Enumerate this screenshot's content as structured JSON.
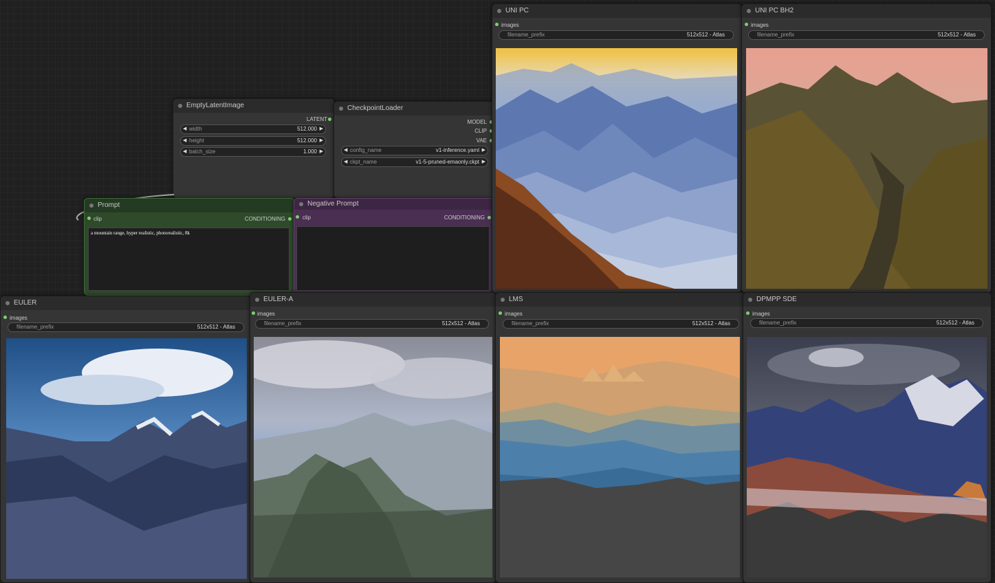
{
  "empty_latent": {
    "title": "EmptyLatentImage",
    "output": "LATENT",
    "widgets": [
      {
        "label": "width",
        "value": "512.000"
      },
      {
        "label": "height",
        "value": "512.000"
      },
      {
        "label": "batch_size",
        "value": "1.000"
      }
    ]
  },
  "checkpoint": {
    "title": "CheckpointLoader",
    "outputs": [
      "MODEL",
      "CLIP",
      "VAE"
    ],
    "widgets": [
      {
        "label": "config_name",
        "value": "v1-inference.yaml"
      },
      {
        "label": "ckpt_name",
        "value": "v1-5-pruned-emaonly.ckpt"
      }
    ]
  },
  "prompt": {
    "title": "Prompt",
    "input": "clip",
    "output": "CONDITIONING",
    "text": "a mountain range, hyper realistic, photorealistic, 8k"
  },
  "negative": {
    "title": "Negative Prompt",
    "input": "clip",
    "output": "CONDITIONING",
    "text": ""
  },
  "previews": [
    {
      "title": "UNI PC",
      "input": "images",
      "prefix_label": "filename_prefix",
      "prefix_value": "512x512 - Atlas"
    },
    {
      "title": "UNI PC BH2",
      "input": "images",
      "prefix_label": "filename_prefix",
      "prefix_value": "512x512 - Atlas"
    },
    {
      "title": "EULER",
      "input": "images",
      "prefix_label": "filename_prefix",
      "prefix_value": "512x512 - Atlas"
    },
    {
      "title": "EULER-A",
      "input": "images",
      "prefix_label": "filename_prefix",
      "prefix_value": "512x512 - Atlas"
    },
    {
      "title": "LMS",
      "input": "images",
      "prefix_label": "filename_prefix",
      "prefix_value": "512x512 - Atlas"
    },
    {
      "title": "DPMPP SDE",
      "input": "images",
      "prefix_label": "filename_prefix",
      "prefix_value": "512x512 - Atlas"
    }
  ],
  "colors": {
    "canvas": "#202020",
    "node": "#353535",
    "prompt_green": "#2e4a2a",
    "negative_purple": "#4a2f52",
    "slot_green": "#7bd16e"
  }
}
